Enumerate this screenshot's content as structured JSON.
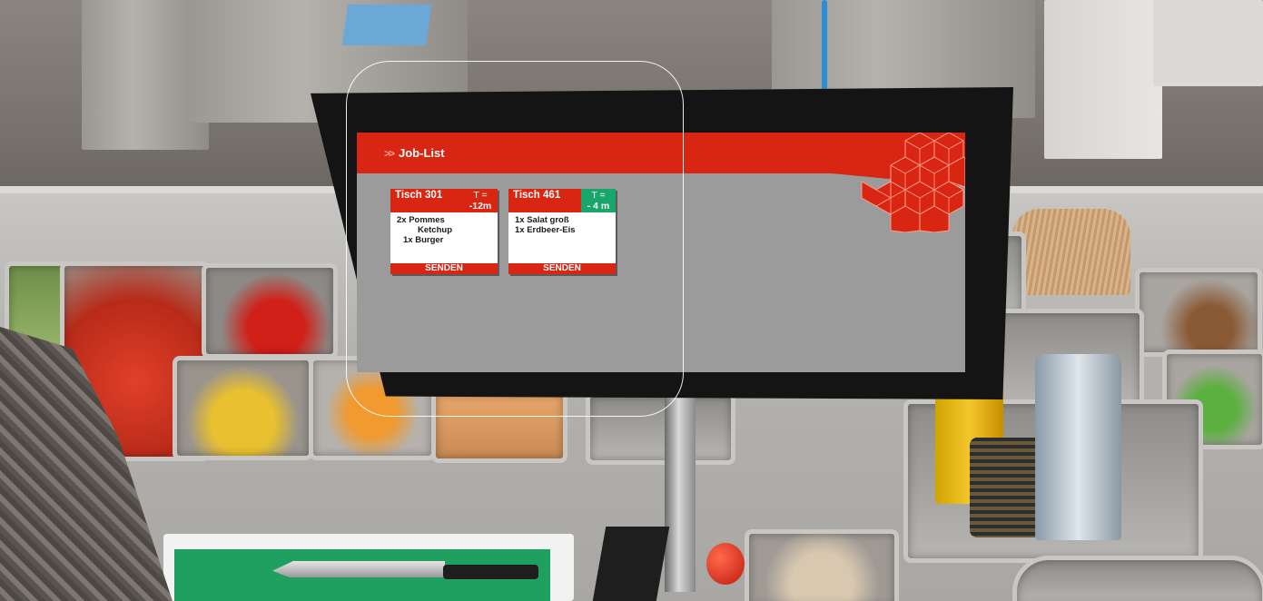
{
  "screen": {
    "header": {
      "arrows": ">>",
      "title": "Job-List"
    },
    "cards": [
      {
        "table": "Tisch 301",
        "time_label": "T =",
        "time_value": "-12m",
        "time_status_color": "#d82612",
        "items": [
          "2x Pommes",
          "Ketchup",
          "1x Burger"
        ],
        "send_label": "SENDEN"
      },
      {
        "table": "Tisch 461",
        "time_label": "T =",
        "time_value": "- 4 m",
        "time_status_color": "#1aa56a",
        "items": [
          "1x Salat groß",
          "1x Erdbeer-Eis"
        ],
        "send_label": "SENDEN"
      }
    ],
    "colors": {
      "accent": "#d82612",
      "background": "#9b9b9b"
    }
  }
}
